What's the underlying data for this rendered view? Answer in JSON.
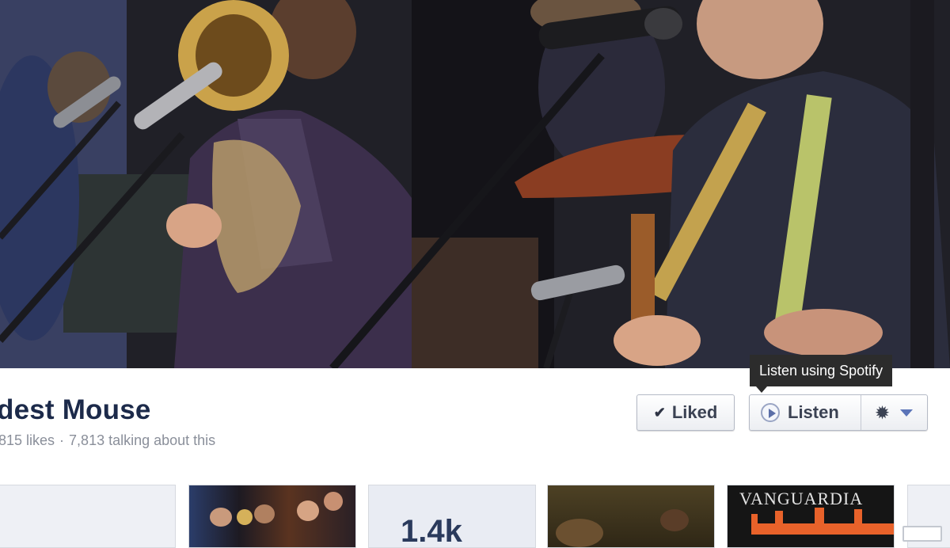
{
  "page": {
    "name": "dest Mouse",
    "likes_text": "815 likes",
    "separator": "·",
    "talking_text": "7,813 talking about this"
  },
  "actions": {
    "liked_label": "Liked",
    "listen_label": "Listen",
    "tooltip": "Listen using Spotify"
  },
  "icons": {
    "liked": "check-icon",
    "listen": "play-icon",
    "settings": "gear-icon",
    "menu": "chevron-down-icon"
  },
  "thumbnails": {
    "stat_partial": "1.4k"
  },
  "watermark": "VANGUARDIA",
  "colors": {
    "page_name": "#1c2a4a",
    "stats_text": "#8a8f9a",
    "tooltip_bg": "#2c2c2c",
    "accent": "#5b74b8"
  }
}
